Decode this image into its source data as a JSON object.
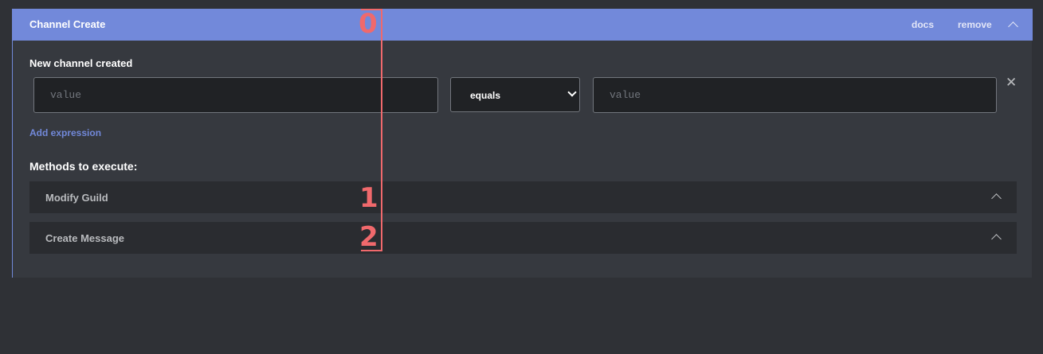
{
  "header": {
    "title": "Channel Create",
    "docs_label": "docs",
    "remove_label": "remove"
  },
  "condition": {
    "title": "New channel created",
    "left_value": "",
    "left_placeholder": "value",
    "operator": "equals",
    "right_value": "",
    "right_placeholder": "value",
    "remove_symbol": "✕",
    "add_expression_label": "Add expression"
  },
  "methods": {
    "title": "Methods to execute:",
    "items": [
      {
        "label": "Modify Guild"
      },
      {
        "label": "Create Message"
      }
    ]
  },
  "overlay": {
    "numbers": [
      "0",
      "1",
      "2"
    ],
    "color": "#f0696c"
  },
  "colors": {
    "accent": "#7289da",
    "background": "#36393f",
    "input_bg": "#202225"
  }
}
